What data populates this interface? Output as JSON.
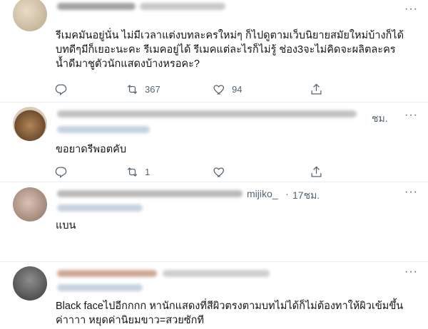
{
  "tweets": [
    {
      "text": "รีเมคมันอยู่นั่น ไม่มีเวลาแต่งบทละครใหม่ๆ ก็ไปดูตามเว็บนิยายสมัยใหม่บ้างก็ได้ บทดีๆมีก็เยอะนะคะ รีเมคอยู่ได้ รีเมคแต่ละไรก็ไม่รู้ ช่อง3จะไม่คิดจะผลิตละครน้ำดีมาชูตัวนักแสดงบ้างหรอคะ?",
      "reply_count": "",
      "retweet_count": "367",
      "like_count": "94"
    },
    {
      "time": "ชม.",
      "text": "ขอยาดรีพอตคับ",
      "reply_count": "",
      "retweet_count": "1",
      "like_count": ""
    },
    {
      "handle_fragment": "mijiko_",
      "time": "17ชม.",
      "text": "แบน"
    },
    {
      "text": "Black faceไปอีกกกก หานักแสดงที่สีผิวตรงตามบทไม่ได้ก็ไม่ต้องทาให้ผิวเข้มขึ้นค่าาาา หยุดค่านิยมขาว=สวยซักที"
    }
  ],
  "icons": {
    "reply": "reply-icon",
    "retweet": "retweet-icon",
    "like": "heart-icon",
    "share": "share-icon",
    "more": "more-horizontal-icon"
  },
  "colors": {
    "text": "#0f1419",
    "muted": "#536471",
    "divider": "#e6ecf0"
  }
}
